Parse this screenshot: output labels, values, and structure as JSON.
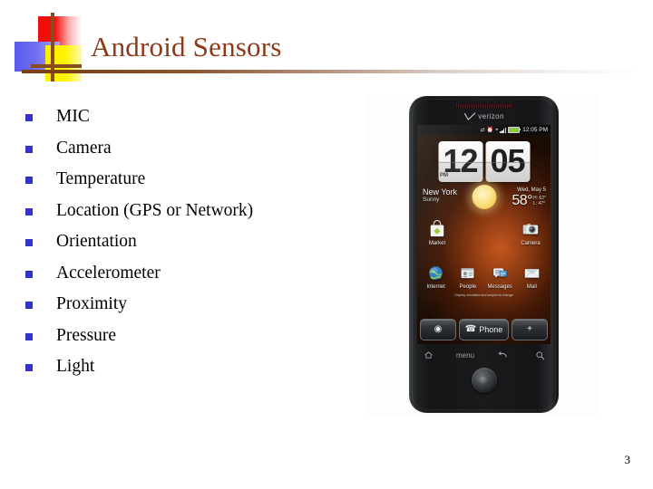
{
  "slide": {
    "title": "Android Sensors",
    "page_number": "3",
    "title_color": "#8B3A1A",
    "bullet_color": "#3333CC"
  },
  "sensors": [
    {
      "label": "MIC"
    },
    {
      "label": "Camera"
    },
    {
      "label": "Temperature"
    },
    {
      "label": "Location (GPS or Network)"
    },
    {
      "label": "Orientation"
    },
    {
      "label": "Accelerometer"
    },
    {
      "label": "Proximity"
    },
    {
      "label": "Pressure"
    },
    {
      "label": "Light"
    }
  ],
  "phone": {
    "carrier": "verizon",
    "status_bar": {
      "time": "12:05 PM"
    },
    "clock": {
      "hours": "12",
      "minutes": "05",
      "ampm": "PM"
    },
    "weather": {
      "city": "New York",
      "condition": "Sunny",
      "date": "Wed, May 5",
      "temperature": "58°",
      "high": "H: 62°",
      "low": "L: 47°"
    },
    "apps_top": [
      {
        "name": "Market",
        "icon": "shopping-bag-icon"
      },
      {
        "name": "Camera",
        "icon": "camera-icon"
      }
    ],
    "apps_bottom": [
      {
        "name": "Internet",
        "icon": "globe-icon"
      },
      {
        "name": "People",
        "icon": "contacts-icon"
      },
      {
        "name": "Messages",
        "icon": "message-icon"
      },
      {
        "name": "Mail",
        "icon": "envelope-icon"
      }
    ],
    "disclaimer": "Display simulated and subject to change",
    "dock": {
      "left_icon": "app-drawer-icon",
      "center_label": "Phone",
      "center_icon": "phone-handset-icon",
      "right_icon": "plus-icon"
    },
    "nav_keys": [
      {
        "name": "home",
        "icon": "home-icon"
      },
      {
        "name": "menu",
        "icon": "menu-label",
        "label": "menu"
      },
      {
        "name": "back",
        "icon": "back-arrow-icon"
      },
      {
        "name": "search",
        "icon": "search-icon"
      }
    ]
  }
}
